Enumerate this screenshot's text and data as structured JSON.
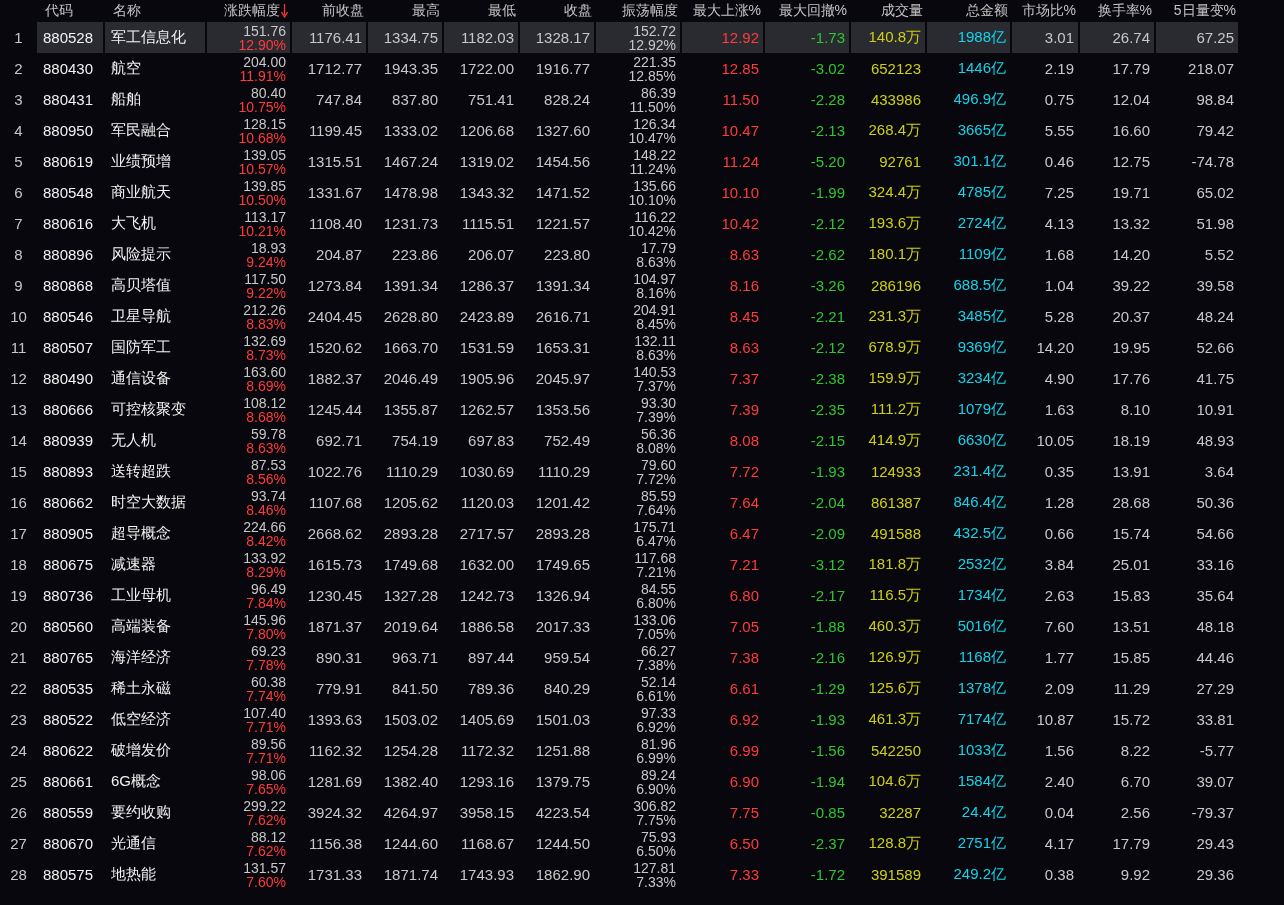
{
  "table": {
    "columns": [
      {
        "kind": "index"
      },
      {
        "label": "代码",
        "kind": "code"
      },
      {
        "label": "名称",
        "kind": "name"
      },
      {
        "label": "涨跌幅度",
        "kind": "dual",
        "sorted_descending": true
      },
      {
        "label": "前收盘",
        "kind": "num"
      },
      {
        "label": "最高",
        "kind": "num"
      },
      {
        "label": "最低",
        "kind": "num"
      },
      {
        "label": "收盘",
        "kind": "num"
      },
      {
        "label": "振荡幅度",
        "kind": "dual_plain"
      },
      {
        "label": "最大上涨%",
        "kind": "up"
      },
      {
        "label": "最大回撤%",
        "kind": "down"
      },
      {
        "label": "成交量",
        "kind": "volume"
      },
      {
        "label": "总金额",
        "kind": "amount"
      },
      {
        "label": "市场比%",
        "kind": "num"
      },
      {
        "label": "换手率%",
        "kind": "num"
      },
      {
        "label": "5日量变%",
        "kind": "num"
      }
    ],
    "rows": [
      {
        "selected": true,
        "cells": [
          "1",
          "880528",
          "军工信息化",
          [
            "151.76",
            "12.90%"
          ],
          "1176.41",
          "1334.75",
          "1182.03",
          "1328.17",
          [
            "152.72",
            "12.92%"
          ],
          "12.92",
          "-1.73",
          "140.8万",
          "1988亿",
          "3.01",
          "26.74",
          "67.25"
        ]
      },
      {
        "selected": false,
        "cells": [
          "2",
          "880430",
          "航空",
          [
            "204.00",
            "11.91%"
          ],
          "1712.77",
          "1943.35",
          "1722.00",
          "1916.77",
          [
            "221.35",
            "12.85%"
          ],
          "12.85",
          "-3.02",
          "652123",
          "1446亿",
          "2.19",
          "17.79",
          "218.07"
        ]
      },
      {
        "selected": false,
        "cells": [
          "3",
          "880431",
          "船舶",
          [
            "80.40",
            "10.75%"
          ],
          "747.84",
          "837.80",
          "751.41",
          "828.24",
          [
            "86.39",
            "11.50%"
          ],
          "11.50",
          "-2.28",
          "433986",
          "496.9亿",
          "0.75",
          "12.04",
          "98.84"
        ]
      },
      {
        "selected": false,
        "cells": [
          "4",
          "880950",
          "军民融合",
          [
            "128.15",
            "10.68%"
          ],
          "1199.45",
          "1333.02",
          "1206.68",
          "1327.60",
          [
            "126.34",
            "10.47%"
          ],
          "10.47",
          "-2.13",
          "268.4万",
          "3665亿",
          "5.55",
          "16.60",
          "79.42"
        ]
      },
      {
        "selected": false,
        "cells": [
          "5",
          "880619",
          "业绩预增",
          [
            "139.05",
            "10.57%"
          ],
          "1315.51",
          "1467.24",
          "1319.02",
          "1454.56",
          [
            "148.22",
            "11.24%"
          ],
          "11.24",
          "-5.20",
          "92761",
          "301.1亿",
          "0.46",
          "12.75",
          "-74.78"
        ]
      },
      {
        "selected": false,
        "cells": [
          "6",
          "880548",
          "商业航天",
          [
            "139.85",
            "10.50%"
          ],
          "1331.67",
          "1478.98",
          "1343.32",
          "1471.52",
          [
            "135.66",
            "10.10%"
          ],
          "10.10",
          "-1.99",
          "324.4万",
          "4785亿",
          "7.25",
          "19.71",
          "65.02"
        ]
      },
      {
        "selected": false,
        "cells": [
          "7",
          "880616",
          "大飞机",
          [
            "113.17",
            "10.21%"
          ],
          "1108.40",
          "1231.73",
          "1115.51",
          "1221.57",
          [
            "116.22",
            "10.42%"
          ],
          "10.42",
          "-2.12",
          "193.6万",
          "2724亿",
          "4.13",
          "13.32",
          "51.98"
        ]
      },
      {
        "selected": false,
        "cells": [
          "8",
          "880896",
          "风险提示",
          [
            "18.93",
            "9.24%"
          ],
          "204.87",
          "223.86",
          "206.07",
          "223.80",
          [
            "17.79",
            "8.63%"
          ],
          "8.63",
          "-2.62",
          "180.1万",
          "1109亿",
          "1.68",
          "14.20",
          "5.52"
        ]
      },
      {
        "selected": false,
        "cells": [
          "9",
          "880868",
          "高贝塔值",
          [
            "117.50",
            "9.22%"
          ],
          "1273.84",
          "1391.34",
          "1286.37",
          "1391.34",
          [
            "104.97",
            "8.16%"
          ],
          "8.16",
          "-3.26",
          "286196",
          "688.5亿",
          "1.04",
          "39.22",
          "39.58"
        ]
      },
      {
        "selected": false,
        "cells": [
          "10",
          "880546",
          "卫星导航",
          [
            "212.26",
            "8.83%"
          ],
          "2404.45",
          "2628.80",
          "2423.89",
          "2616.71",
          [
            "204.91",
            "8.45%"
          ],
          "8.45",
          "-2.21",
          "231.3万",
          "3485亿",
          "5.28",
          "20.37",
          "48.24"
        ]
      },
      {
        "selected": false,
        "cells": [
          "11",
          "880507",
          "国防军工",
          [
            "132.69",
            "8.73%"
          ],
          "1520.62",
          "1663.70",
          "1531.59",
          "1653.31",
          [
            "132.11",
            "8.63%"
          ],
          "8.63",
          "-2.12",
          "678.9万",
          "9369亿",
          "14.20",
          "19.95",
          "52.66"
        ]
      },
      {
        "selected": false,
        "cells": [
          "12",
          "880490",
          "通信设备",
          [
            "163.60",
            "8.69%"
          ],
          "1882.37",
          "2046.49",
          "1905.96",
          "2045.97",
          [
            "140.53",
            "7.37%"
          ],
          "7.37",
          "-2.38",
          "159.9万",
          "3234亿",
          "4.90",
          "17.76",
          "41.75"
        ]
      },
      {
        "selected": false,
        "cells": [
          "13",
          "880666",
          "可控核聚变",
          [
            "108.12",
            "8.68%"
          ],
          "1245.44",
          "1355.87",
          "1262.57",
          "1353.56",
          [
            "93.30",
            "7.39%"
          ],
          "7.39",
          "-2.35",
          "111.2万",
          "1079亿",
          "1.63",
          "8.10",
          "10.91"
        ]
      },
      {
        "selected": false,
        "cells": [
          "14",
          "880939",
          "无人机",
          [
            "59.78",
            "8.63%"
          ],
          "692.71",
          "754.19",
          "697.83",
          "752.49",
          [
            "56.36",
            "8.08%"
          ],
          "8.08",
          "-2.15",
          "414.9万",
          "6630亿",
          "10.05",
          "18.19",
          "48.93"
        ]
      },
      {
        "selected": false,
        "cells": [
          "15",
          "880893",
          "送转超跌",
          [
            "87.53",
            "8.56%"
          ],
          "1022.76",
          "1110.29",
          "1030.69",
          "1110.29",
          [
            "79.60",
            "7.72%"
          ],
          "7.72",
          "-1.93",
          "124933",
          "231.4亿",
          "0.35",
          "13.91",
          "3.64"
        ]
      },
      {
        "selected": false,
        "cells": [
          "16",
          "880662",
          "时空大数据",
          [
            "93.74",
            "8.46%"
          ],
          "1107.68",
          "1205.62",
          "1120.03",
          "1201.42",
          [
            "85.59",
            "7.64%"
          ],
          "7.64",
          "-2.04",
          "861387",
          "846.4亿",
          "1.28",
          "28.68",
          "50.36"
        ]
      },
      {
        "selected": false,
        "cells": [
          "17",
          "880905",
          "超导概念",
          [
            "224.66",
            "8.42%"
          ],
          "2668.62",
          "2893.28",
          "2717.57",
          "2893.28",
          [
            "175.71",
            "6.47%"
          ],
          "6.47",
          "-2.09",
          "491588",
          "432.5亿",
          "0.66",
          "15.74",
          "54.66"
        ]
      },
      {
        "selected": false,
        "cells": [
          "18",
          "880675",
          "减速器",
          [
            "133.92",
            "8.29%"
          ],
          "1615.73",
          "1749.68",
          "1632.00",
          "1749.65",
          [
            "117.68",
            "7.21%"
          ],
          "7.21",
          "-3.12",
          "181.8万",
          "2532亿",
          "3.84",
          "25.01",
          "33.16"
        ]
      },
      {
        "selected": false,
        "cells": [
          "19",
          "880736",
          "工业母机",
          [
            "96.49",
            "7.84%"
          ],
          "1230.45",
          "1327.28",
          "1242.73",
          "1326.94",
          [
            "84.55",
            "6.80%"
          ],
          "6.80",
          "-2.17",
          "116.5万",
          "1734亿",
          "2.63",
          "15.83",
          "35.64"
        ]
      },
      {
        "selected": false,
        "cells": [
          "20",
          "880560",
          "高端装备",
          [
            "145.96",
            "7.80%"
          ],
          "1871.37",
          "2019.64",
          "1886.58",
          "2017.33",
          [
            "133.06",
            "7.05%"
          ],
          "7.05",
          "-1.88",
          "460.3万",
          "5016亿",
          "7.60",
          "13.51",
          "48.18"
        ]
      },
      {
        "selected": false,
        "cells": [
          "21",
          "880765",
          "海洋经济",
          [
            "69.23",
            "7.78%"
          ],
          "890.31",
          "963.71",
          "897.44",
          "959.54",
          [
            "66.27",
            "7.38%"
          ],
          "7.38",
          "-2.16",
          "126.9万",
          "1168亿",
          "1.77",
          "15.85",
          "44.46"
        ]
      },
      {
        "selected": false,
        "cells": [
          "22",
          "880535",
          "稀土永磁",
          [
            "60.38",
            "7.74%"
          ],
          "779.91",
          "841.50",
          "789.36",
          "840.29",
          [
            "52.14",
            "6.61%"
          ],
          "6.61",
          "-1.29",
          "125.6万",
          "1378亿",
          "2.09",
          "11.29",
          "27.29"
        ]
      },
      {
        "selected": false,
        "cells": [
          "23",
          "880522",
          "低空经济",
          [
            "107.40",
            "7.71%"
          ],
          "1393.63",
          "1503.02",
          "1405.69",
          "1501.03",
          [
            "97.33",
            "6.92%"
          ],
          "6.92",
          "-1.93",
          "461.3万",
          "7174亿",
          "10.87",
          "15.72",
          "33.81"
        ]
      },
      {
        "selected": false,
        "cells": [
          "24",
          "880622",
          "破增发价",
          [
            "89.56",
            "7.71%"
          ],
          "1162.32",
          "1254.28",
          "1172.32",
          "1251.88",
          [
            "81.96",
            "6.99%"
          ],
          "6.99",
          "-1.56",
          "542250",
          "1033亿",
          "1.56",
          "8.22",
          "-5.77"
        ]
      },
      {
        "selected": false,
        "cells": [
          "25",
          "880661",
          "6G概念",
          [
            "98.06",
            "7.65%"
          ],
          "1281.69",
          "1382.40",
          "1293.16",
          "1379.75",
          [
            "89.24",
            "6.90%"
          ],
          "6.90",
          "-1.94",
          "104.6万",
          "1584亿",
          "2.40",
          "6.70",
          "39.07"
        ]
      },
      {
        "selected": false,
        "cells": [
          "26",
          "880559",
          "要约收购",
          [
            "299.22",
            "7.62%"
          ],
          "3924.32",
          "4264.97",
          "3958.15",
          "4223.54",
          [
            "306.82",
            "7.75%"
          ],
          "7.75",
          "-0.85",
          "32287",
          "24.4亿",
          "0.04",
          "2.56",
          "-79.37"
        ]
      },
      {
        "selected": false,
        "cells": [
          "27",
          "880670",
          "光通信",
          [
            "88.12",
            "7.62%"
          ],
          "1156.38",
          "1244.60",
          "1168.67",
          "1244.50",
          [
            "75.93",
            "6.50%"
          ],
          "6.50",
          "-2.37",
          "128.8万",
          "2751亿",
          "4.17",
          "17.79",
          "29.43"
        ]
      },
      {
        "selected": false,
        "cells": [
          "28",
          "880575",
          "地热能",
          [
            "131.57",
            "7.60%"
          ],
          "1731.33",
          "1871.74",
          "1743.93",
          "1862.90",
          [
            "127.81",
            "7.33%"
          ],
          "7.33",
          "-1.72",
          "391589",
          "249.2亿",
          "0.38",
          "9.92",
          "29.36"
        ]
      }
    ]
  }
}
